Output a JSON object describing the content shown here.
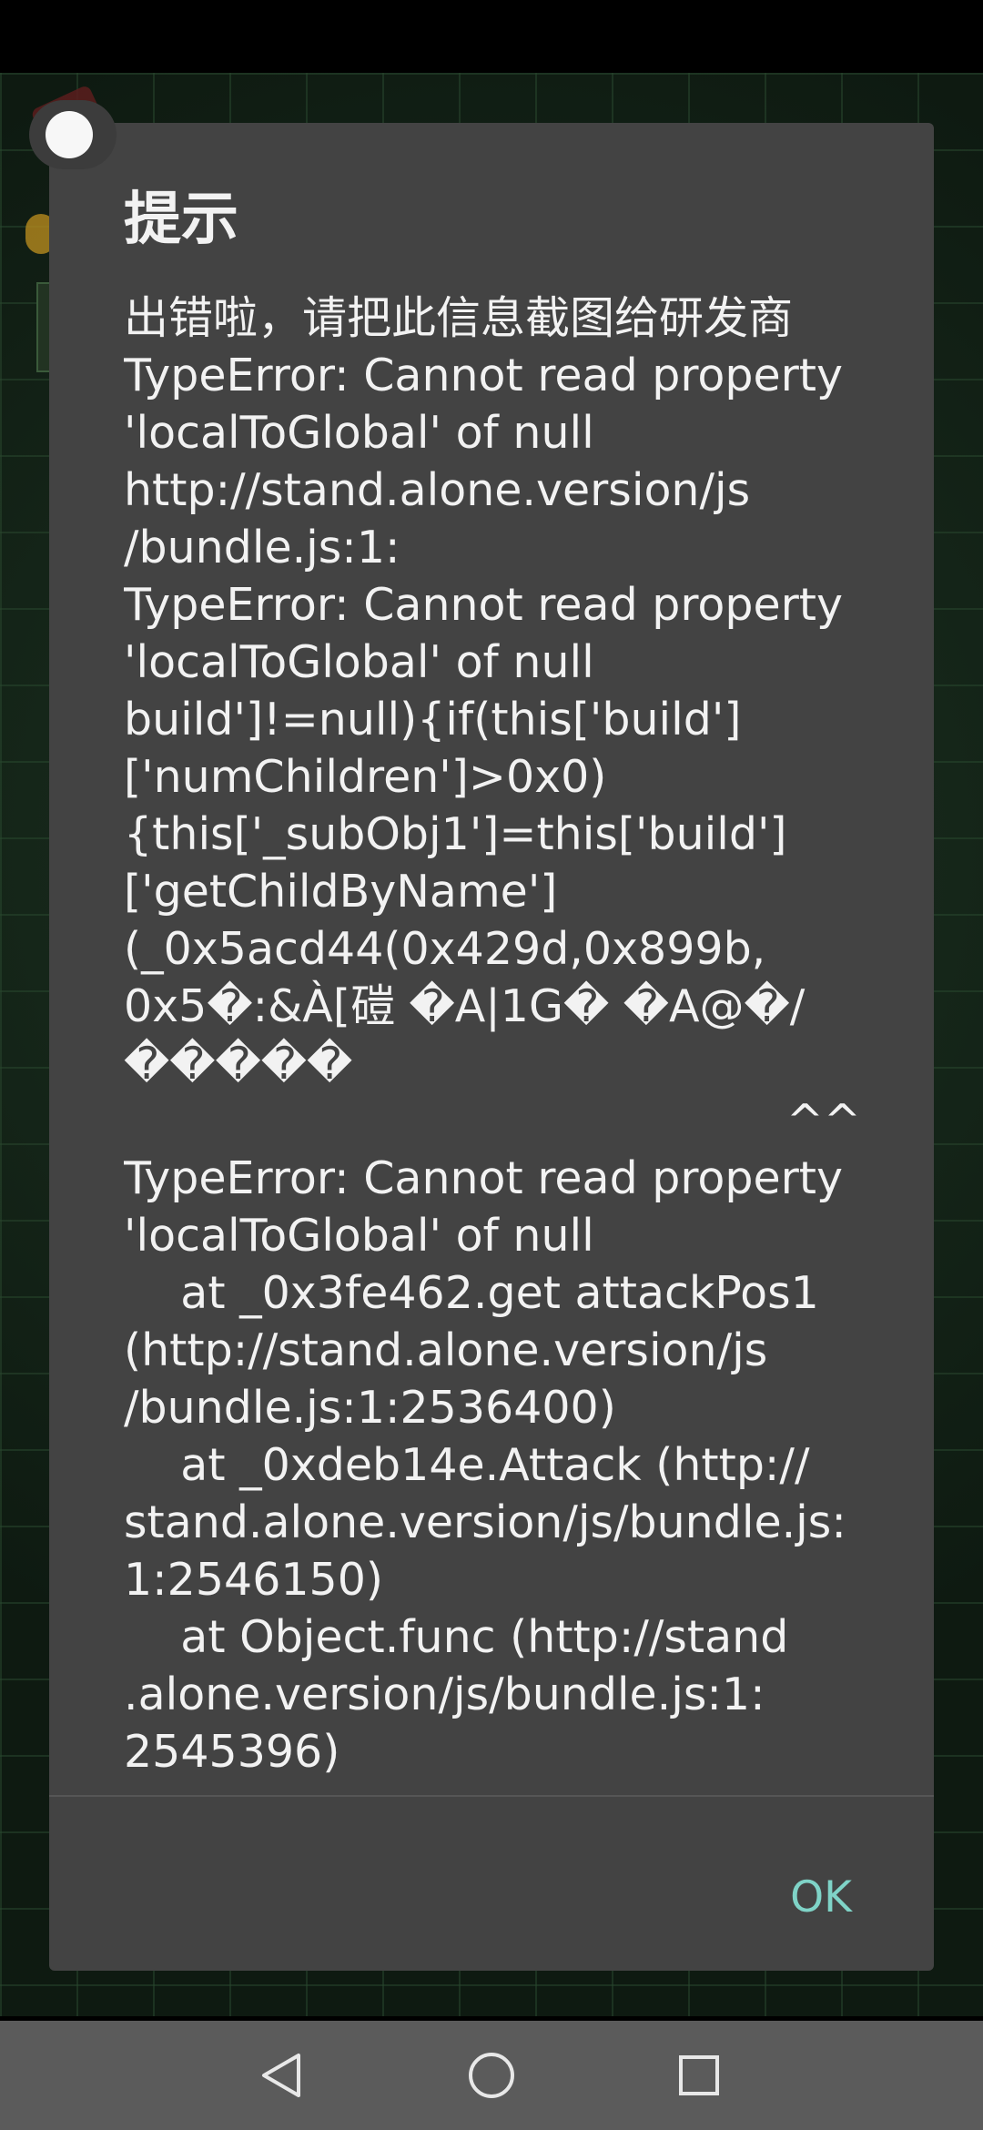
{
  "dialog": {
    "title": "提示",
    "message_lines": [
      {
        "text": "出错啦，请把此信息截图给研发商"
      },
      {
        "text": "TypeError: Cannot read property"
      },
      {
        "text": "'localToGlobal' of null"
      },
      {
        "text": "http://stand.alone.version/js"
      },
      {
        "text": "/bundle.js:1:"
      },
      {
        "text": "TypeError: Cannot read property"
      },
      {
        "text": "'localToGlobal' of null"
      },
      {
        "text": "build']!=null){if(this['build']"
      },
      {
        "text": "['numChildren']>0x0)"
      },
      {
        "text": "{this['_subObj1']=this['build']"
      },
      {
        "text": "['getChildByName']"
      },
      {
        "text": "(_0x5acd44(0x429d,0x899b,"
      },
      {
        "text": "0x5�:&À[磑 �A|1G� �A@�/"
      },
      {
        "text": "�����"
      },
      {
        "text": "^^",
        "align": "right"
      },
      {
        "text": "TypeError: Cannot read property"
      },
      {
        "text": "'localToGlobal' of null"
      },
      {
        "text": "    at _0x3fe462.get attackPos1"
      },
      {
        "text": "(http://stand.alone.version/js"
      },
      {
        "text": "/bundle.js:1:2536400)"
      },
      {
        "text": "    at _0xdeb14e.Attack (http://"
      },
      {
        "text": "stand.alone.version/js/bundle.js:"
      },
      {
        "text": "1:2546150)"
      },
      {
        "text": "    at Object.func (http://stand"
      },
      {
        "text": ".alone.version/js/bundle.js:1:"
      },
      {
        "text": "2545396)"
      }
    ],
    "ok_label": "OK"
  },
  "nav": {
    "back_icon": "back-triangle-icon",
    "home_icon": "home-circle-icon",
    "recents_icon": "recents-square-icon"
  },
  "colors": {
    "dialog_bg": "#434343",
    "text": "#f2f2f2",
    "accent": "#7fd3c7",
    "nav_bg": "#5b5b5b"
  }
}
